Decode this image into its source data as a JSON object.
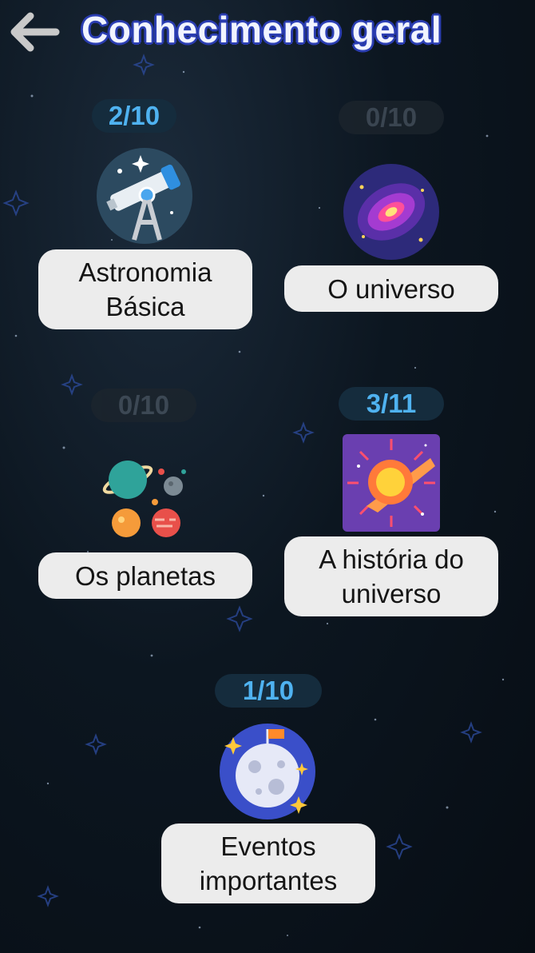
{
  "header": {
    "title": "Conhecimento geral",
    "back_icon": "arrow-left-icon"
  },
  "colors": {
    "background": "#0c1620",
    "progress_active": "#4fb2f0",
    "progress_inactive": "#4a5561",
    "label_bg": "#ececec",
    "title_outline": "#2a3cae"
  },
  "topics": [
    {
      "name": "Astronomia Básica",
      "progress": "2/10",
      "icon": "telescope-icon"
    },
    {
      "name": "O universo",
      "progress": "0/10",
      "icon": "galaxy-icon"
    },
    {
      "name": "Os planetas",
      "progress": "0/10",
      "icon": "planets-icon"
    },
    {
      "name": "A história do universo",
      "progress": "3/11",
      "icon": "big-bang-icon"
    },
    {
      "name": "Eventos importantes",
      "progress": "1/10",
      "icon": "moon-landing-icon"
    }
  ]
}
